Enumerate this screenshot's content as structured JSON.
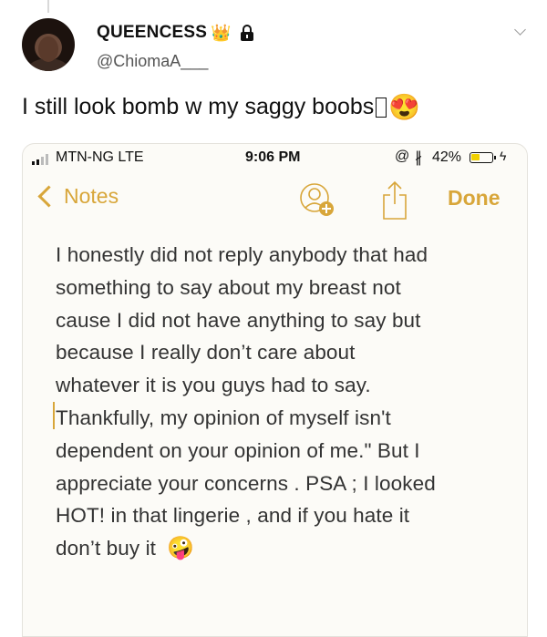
{
  "tweet": {
    "display_name": "QUEENCESS",
    "crown_emoji": "👑",
    "handle": "@ChiomaA___",
    "text": "I still look bomb w my saggy boobs",
    "heart_eyes_emoji": "😍"
  },
  "status_bar": {
    "carrier": "MTN-NG   LTE",
    "time": "9:06 PM",
    "at_symbol": "@",
    "bluetooth": "∦",
    "battery": "42%",
    "battery_level": 0.42,
    "bolt": "ϟ"
  },
  "notes_nav": {
    "back_label": "Notes",
    "done_label": "Done"
  },
  "note": {
    "lines": [
      "I honestly did not reply anybody that had",
      "something to say about my breast not",
      "cause I did not have anything to say but",
      "because I really don’t care about",
      "whatever it is you guys had to say.",
      "Thankfully, my opinion of myself isn't",
      "dependent on your opinion of me.\" But I",
      "appreciate your concerns  . PSA ; I looked",
      "HOT! in that lingerie , and if you hate it",
      "don’t buy it"
    ],
    "end_emoji": "🤪"
  },
  "colors": {
    "accent": "#d8a63a",
    "note_background": "#fcfbf7"
  }
}
